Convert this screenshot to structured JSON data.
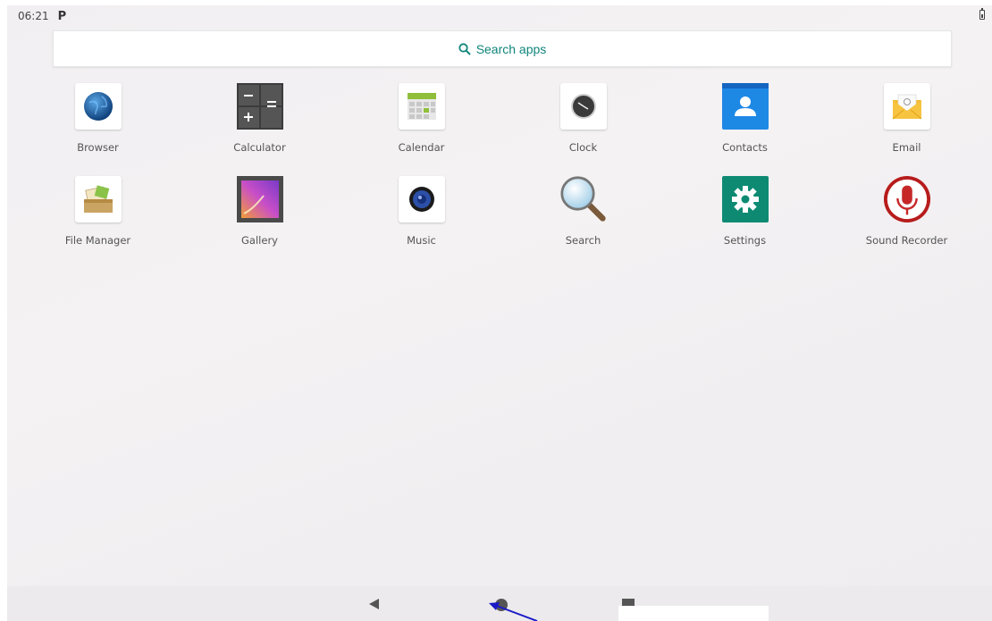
{
  "status_bar": {
    "time": "06:21",
    "notification_icon": "p-icon",
    "battery_icon": "battery-icon"
  },
  "search": {
    "placeholder": "Search apps",
    "icon": "search-icon",
    "accent_color": "#10857a"
  },
  "apps": [
    {
      "label": "Browser",
      "icon": "globe-icon"
    },
    {
      "label": "Calculator",
      "icon": "calculator-icon"
    },
    {
      "label": "Calendar",
      "icon": "calendar-icon"
    },
    {
      "label": "Clock",
      "icon": "clock-icon"
    },
    {
      "label": "Contacts",
      "icon": "contacts-icon"
    },
    {
      "label": "Email",
      "icon": "email-icon"
    },
    {
      "label": "File Manager",
      "icon": "file-manager-icon"
    },
    {
      "label": "Gallery",
      "icon": "gallery-icon"
    },
    {
      "label": "Music",
      "icon": "music-icon"
    },
    {
      "label": "Search",
      "icon": "magnifier-icon"
    },
    {
      "label": "Settings",
      "icon": "gear-icon"
    },
    {
      "label": "Sound Recorder",
      "icon": "microphone-icon"
    }
  ],
  "nav_bar": {
    "back_icon": "back-icon",
    "home_icon": "home-icon",
    "recents_icon": "recents-icon"
  }
}
